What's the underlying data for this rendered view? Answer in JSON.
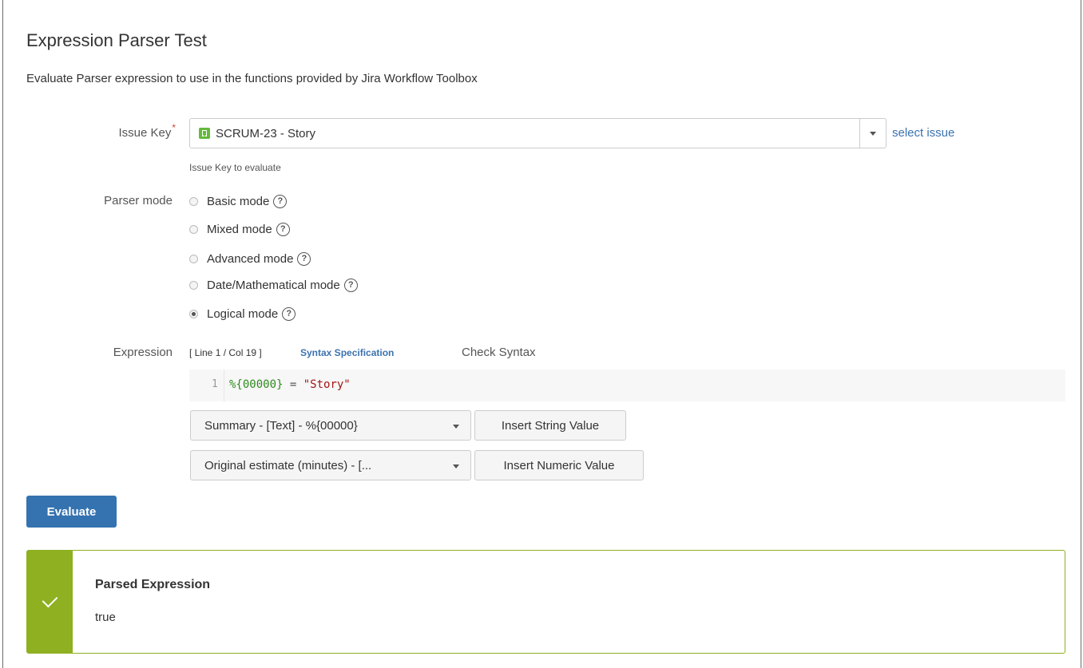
{
  "page": {
    "title": "Expression Parser Test",
    "description": "Evaluate Parser expression to use in the functions provided by Jira Workflow Toolbox"
  },
  "issue_key": {
    "label": "Issue Key",
    "required_marker": "*",
    "value": "SCRUM-23 - Story",
    "issue_type_icon": "story-icon",
    "select_issue_link": "select issue",
    "hint": "Issue Key to evaluate"
  },
  "parser_mode": {
    "label": "Parser mode",
    "options": [
      {
        "label": "Basic mode",
        "checked": false
      },
      {
        "label": "Mixed mode",
        "checked": false
      },
      {
        "label": "Advanced mode",
        "checked": false
      },
      {
        "label": "Date/Mathematical mode",
        "checked": false
      },
      {
        "label": "Logical mode",
        "checked": true
      }
    ],
    "help_glyph": "?"
  },
  "expression": {
    "label": "Expression",
    "cursor_position": "[ Line 1 / Col 19 ]",
    "syntax_link": "Syntax Specification",
    "check_syntax": "Check Syntax",
    "line_number": "1",
    "code": {
      "field": "%{00000}",
      "operator": " = ",
      "string": "\"Story\""
    },
    "string_field_select": "Summary - [Text] - %{00000}",
    "insert_string_button": "Insert String Value",
    "numeric_field_select": "Original estimate (minutes) - [...",
    "insert_numeric_button": "Insert Numeric Value"
  },
  "evaluate_button": "Evaluate",
  "result": {
    "status": "success",
    "title": "Parsed Expression",
    "value": "true"
  },
  "colors": {
    "primary_button": "#3572b0",
    "link": "#3b73af",
    "success": "#8eb021",
    "required": "#d04437",
    "story_icon": "#63ba3c"
  }
}
